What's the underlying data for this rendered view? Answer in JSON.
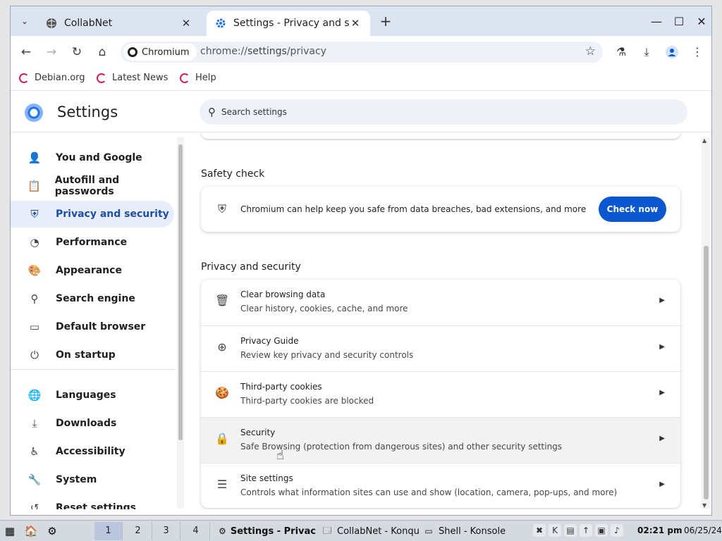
{
  "tabs": [
    {
      "title": "CollabNet",
      "active": false
    },
    {
      "title": "Settings - Privacy and sec",
      "active": true
    }
  ],
  "toolbar": {
    "site_chip": "Chromium",
    "url_scheme": "chrome://",
    "url_host": "settings",
    "url_path": "/privacy"
  },
  "bookmarks": [
    "Debian.org",
    "Latest News",
    "Help"
  ],
  "settings": {
    "title": "Settings",
    "search_placeholder": "Search settings"
  },
  "sidebar": {
    "items": [
      {
        "label": "You and Google",
        "icon": "person-icon"
      },
      {
        "label": "Autofill and passwords",
        "icon": "clipboard-icon"
      },
      {
        "label": "Privacy and security",
        "icon": "shield-icon",
        "active": true
      },
      {
        "label": "Performance",
        "icon": "speedometer-icon"
      },
      {
        "label": "Appearance",
        "icon": "palette-icon"
      },
      {
        "label": "Search engine",
        "icon": "search-icon"
      },
      {
        "label": "Default browser",
        "icon": "browser-icon"
      },
      {
        "label": "On startup",
        "icon": "power-icon"
      },
      {
        "label": "Languages",
        "icon": "globe-icon"
      },
      {
        "label": "Downloads",
        "icon": "download-icon"
      },
      {
        "label": "Accessibility",
        "icon": "accessibility-icon"
      },
      {
        "label": "System",
        "icon": "wrench-icon"
      },
      {
        "label": "Reset settings",
        "icon": "history-icon"
      }
    ]
  },
  "safety_check": {
    "heading": "Safety check",
    "text": "Chromium can help keep you safe from data breaches, bad extensions, and more",
    "button": "Check now"
  },
  "privacy": {
    "heading": "Privacy and security",
    "rows": [
      {
        "title": "Clear browsing data",
        "subtitle": "Clear history, cookies, cache, and more",
        "icon": "trash-icon"
      },
      {
        "title": "Privacy Guide",
        "subtitle": "Review key privacy and security controls",
        "icon": "compass-icon"
      },
      {
        "title": "Third-party cookies",
        "subtitle": "Third-party cookies are blocked",
        "icon": "cookie-icon"
      },
      {
        "title": "Security",
        "subtitle": "Safe Browsing (protection from dangerous sites) and other security settings",
        "icon": "lock-icon",
        "hovered": true
      },
      {
        "title": "Site settings",
        "subtitle": "Controls what information sites can use and show (location, camera, pop-ups, and more)",
        "icon": "sliders-icon"
      }
    ]
  },
  "taskbar": {
    "desktops": [
      "1",
      "2",
      "3",
      "4"
    ],
    "tasks": [
      {
        "label": "Settings - Privac",
        "active": true
      },
      {
        "label": "CollabNet - Konqu",
        "active": false
      },
      {
        "label": "Shell - Konsole",
        "active": false
      }
    ],
    "clock": "02:21 pm",
    "date": "06/25/24"
  }
}
